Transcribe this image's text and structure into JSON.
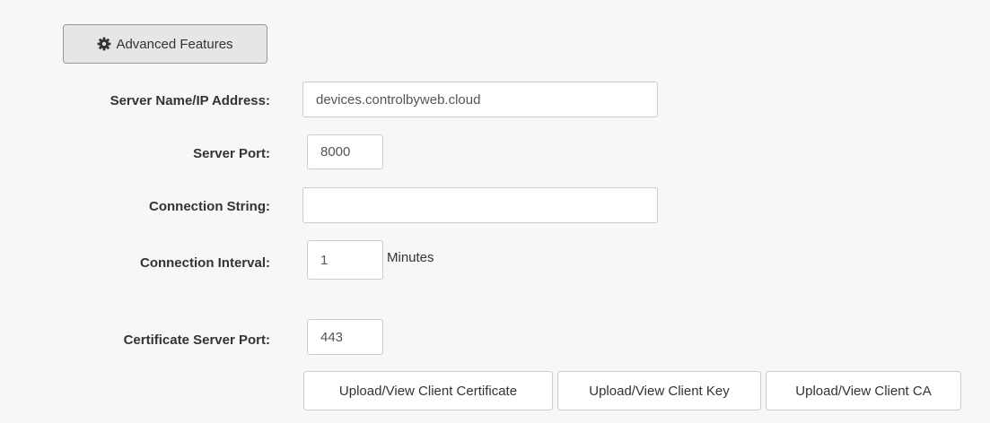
{
  "advanced_button": {
    "label": "Advanced Features",
    "icon": "gear-icon"
  },
  "fields": {
    "server_name": {
      "label": "Server Name/IP Address:",
      "value": "devices.controlbyweb.cloud"
    },
    "server_port": {
      "label": "Server Port:",
      "value": "8000"
    },
    "connection_string": {
      "label": "Connection String:",
      "value": ""
    },
    "connection_interval": {
      "label": "Connection Interval:",
      "value": "1",
      "unit": "Minutes"
    },
    "certificate_server_port": {
      "label": "Certificate Server Port:",
      "value": "443"
    }
  },
  "upload_buttons": {
    "client_certificate": "Upload/View Client Certificate",
    "client_key": "Upload/View Client Key",
    "client_ca": "Upload/View Client CA"
  }
}
